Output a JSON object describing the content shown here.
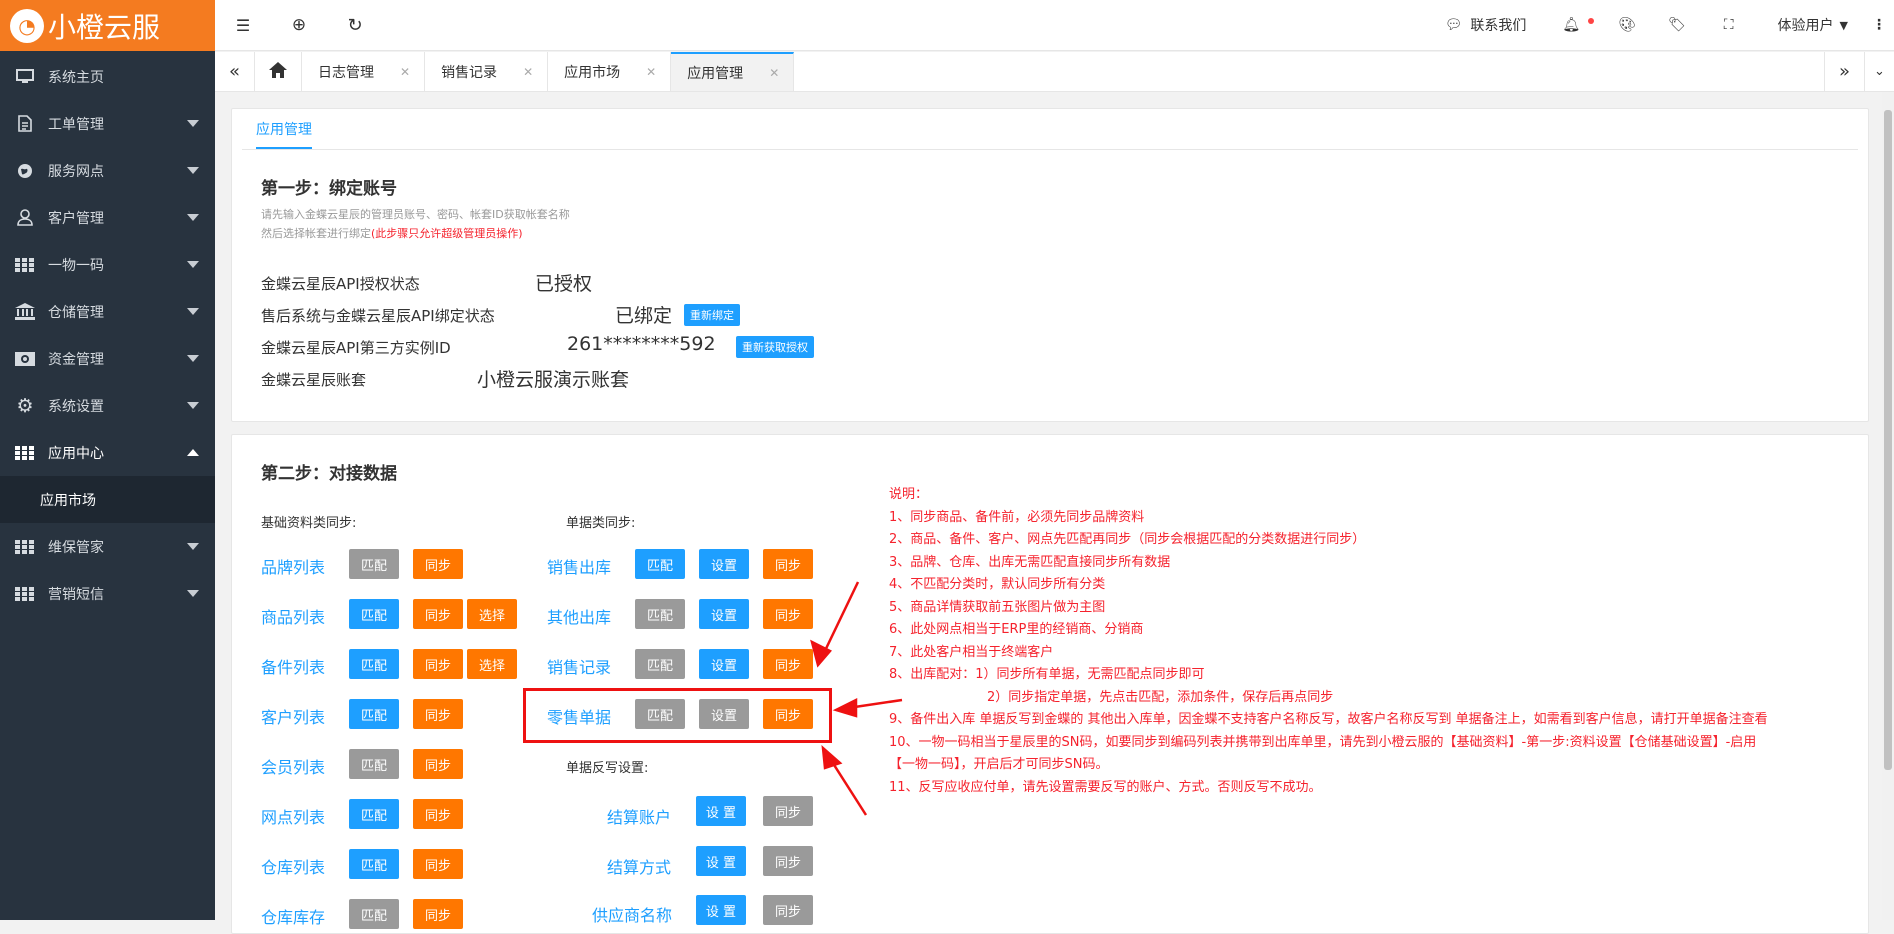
{
  "app": {
    "brand": "小橙云服",
    "brand_color": "#f47b20"
  },
  "sidebar": {
    "items": [
      {
        "label": "系统主页",
        "icon": "monitor-icon"
      },
      {
        "label": "工单管理",
        "icon": "document-icon"
      },
      {
        "label": "服务网点",
        "icon": "globe-icon"
      },
      {
        "label": "客户管理",
        "icon": "user-icon"
      },
      {
        "label": "一物一码",
        "icon": "grid-icon"
      },
      {
        "label": "仓储管理",
        "icon": "bank-icon"
      },
      {
        "label": "资金管理",
        "icon": "money-icon"
      },
      {
        "label": "系统设置",
        "icon": "gear-icon"
      },
      {
        "label": "应用中心",
        "icon": "grid-icon"
      },
      {
        "label": "维保管家",
        "icon": "grid-icon"
      },
      {
        "label": "营销短信",
        "icon": "grid-icon"
      }
    ],
    "sub_item": "应用市场"
  },
  "topbar": {
    "contact": "联系我们",
    "user": "体验用户"
  },
  "tabs": [
    {
      "label": "日志管理"
    },
    {
      "label": "销售记录"
    },
    {
      "label": "应用市场"
    },
    {
      "label": "应用管理"
    }
  ],
  "panel1": {
    "tab": "应用管理",
    "title": "第一步：绑定账号",
    "hint1": "请先输入金蝶云星辰的管理员账号、密码、帐套ID获取帐套名称",
    "hint2": "然后选择帐套进行绑定",
    "hint2_red": "(此步骤只允许超级管理员操作)",
    "rows": [
      {
        "label": "金蝶云星辰API授权状态",
        "value": "已授权",
        "badge": ""
      },
      {
        "label": "售后系统与金蝶云星辰API绑定状态",
        "value": "已绑定",
        "badge": "重新绑定"
      },
      {
        "label": "金蝶云星辰API第三方实例ID",
        "value": "261********592",
        "badge": "重新获取授权"
      },
      {
        "label": "金蝶云星辰账套",
        "value": "小橙云服演示账套",
        "badge": ""
      }
    ]
  },
  "panel2": {
    "title": "第二步：对接数据",
    "basic_label": "基础资料类同步:",
    "doc_label": "单据类同步:",
    "write_label": "单据反写设置:",
    "buttons": {
      "match": "匹配",
      "sync": "同步",
      "select": "选择",
      "setting": "设置",
      "setting_spaced": "设 置"
    },
    "basic": [
      "品牌列表",
      "商品列表",
      "备件列表",
      "客户列表",
      "会员列表",
      "网点列表",
      "仓库列表",
      "仓库库存"
    ],
    "docs": [
      "销售出库",
      "其他出库",
      "销售记录",
      "零售单据"
    ],
    "write": [
      "结算账户",
      "结算方式",
      "供应商名称"
    ],
    "notes": [
      "说明：",
      "1、同步商品、备件前，必须先同步品牌资料",
      "2、商品、备件、客户、网点先匹配再同步（同步会根据匹配的分类数据进行同步）",
      "3、品牌、仓库、出库无需匹配直接同步所有数据",
      "4、不匹配分类时，默认同步所有分类",
      "5、商品详情获取前五张图片做为主图",
      "6、此处网点相当于ERP里的经销商、分销商",
      "7、此处客户相当于终端客户",
      "8、出库配对：1）同步所有单据，无需匹配点同步即可",
      "2）同步指定单据，先点击匹配，添加条件，保存后再点同步",
      "9、备件出入库 单据反写到金蝶的 其他出入库单，因金蝶不支持客户名称反写，故客户名称反写到 单据备注上，如需看到客户信息，请打开单据备注查看",
      "10、一物一码相当于星辰里的SN码，如要同步到编码列表并携带到出库单里，请先到小橙云服的【基础资料】-第一步:资料设置【仓储基础设置】-启用【一物一码】，开启后才可同步SN码。",
      "11、反写应收应付单，请先设置需要反写的账户、方式。否则反写不成功。"
    ]
  }
}
